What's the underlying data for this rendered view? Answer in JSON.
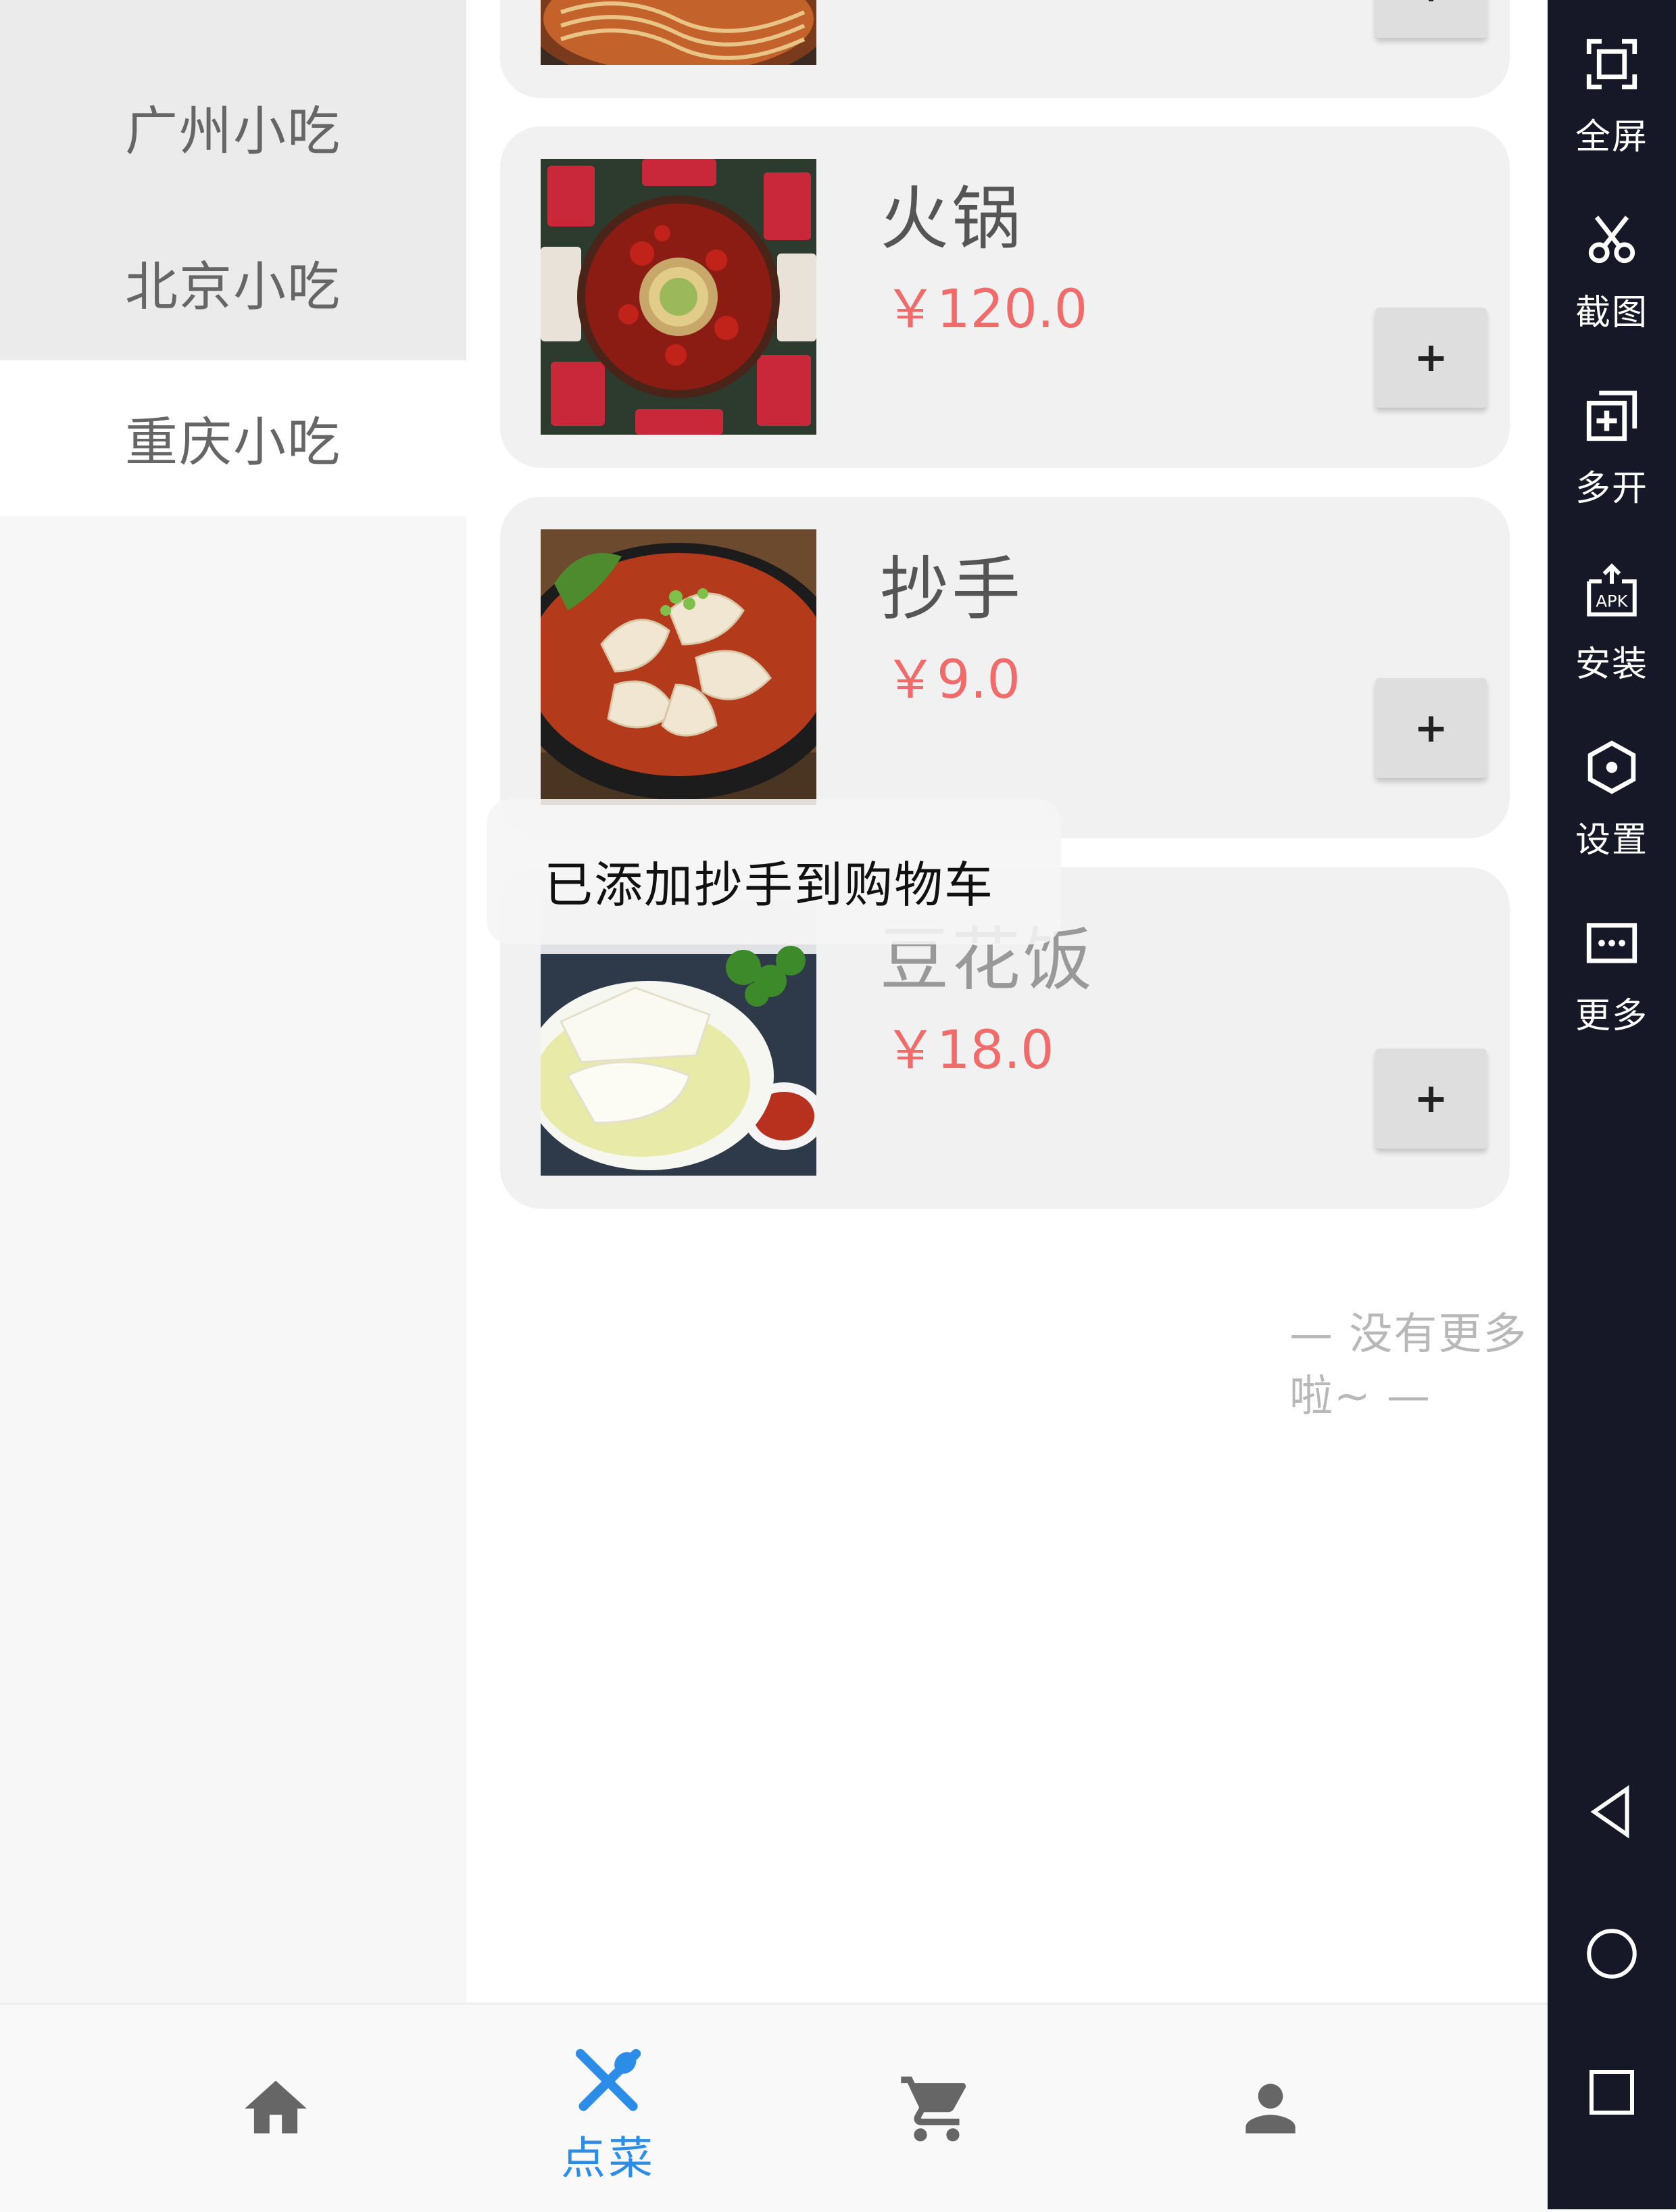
{
  "sidebar": {
    "categories": [
      {
        "label": "广州小吃",
        "state": "inactive"
      },
      {
        "label": "北京小吃",
        "state": "inactive"
      },
      {
        "label": "重庆小吃",
        "state": "active"
      }
    ]
  },
  "dishes": [
    {
      "name": "",
      "price": "",
      "add_label": "+",
      "image": "noodles-photo"
    },
    {
      "name": "火锅",
      "price": "￥120.0",
      "add_label": "+",
      "image": "hotpot-photo"
    },
    {
      "name": "抄手",
      "price": "￥9.0",
      "add_label": "+",
      "image": "wonton-photo"
    },
    {
      "name": "豆花饭",
      "price": "￥18.0",
      "add_label": "+",
      "image": "tofu-pudding-photo"
    }
  ],
  "toast": {
    "message": "已添加抄手到购物车"
  },
  "list_footer": "— 没有更多啦~ —",
  "bottom_nav": {
    "items": [
      {
        "icon": "home-icon",
        "label": ""
      },
      {
        "icon": "utensils-icon",
        "label": "点菜",
        "active": true
      },
      {
        "icon": "cart-icon",
        "label": ""
      },
      {
        "icon": "person-icon",
        "label": ""
      }
    ],
    "active_color": "#2c8de8"
  },
  "emulator_toolbar": {
    "tools": [
      {
        "icon": "fullscreen-icon",
        "label": "全屏"
      },
      {
        "icon": "scissors-icon",
        "label": "截图"
      },
      {
        "icon": "multi-open-icon",
        "label": "多开"
      },
      {
        "icon": "apk-install-icon",
        "label": "安装"
      },
      {
        "icon": "settings-icon",
        "label": "设置"
      },
      {
        "icon": "more-icon",
        "label": "更多"
      }
    ],
    "system_buttons": [
      "back-icon",
      "home-circle-icon",
      "recents-icon"
    ]
  },
  "colors": {
    "price": "#f26b6b",
    "card_bg": "#f1f1f1",
    "toolbar_bg": "#171827",
    "footer_text": "#b8b8b8"
  }
}
